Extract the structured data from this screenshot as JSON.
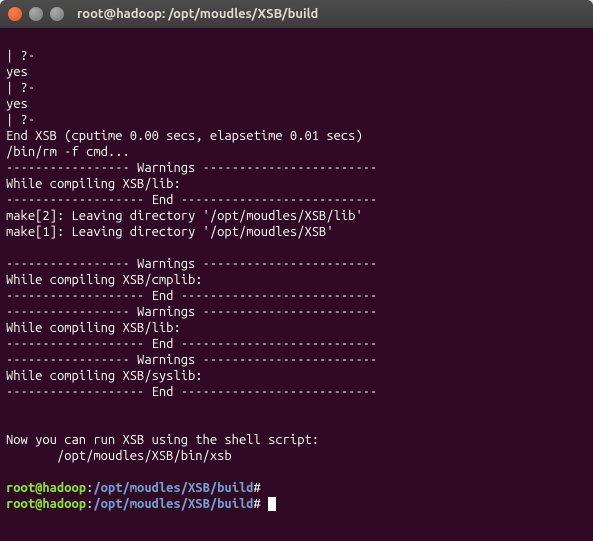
{
  "window": {
    "title": "root@hadoop: /opt/moudles/XSB/build"
  },
  "prompt": {
    "user_host": "root@hadoop",
    "sep": ":",
    "path": "/opt/moudles/XSB/build",
    "end": "#"
  },
  "lines": {
    "l0": "| ?-",
    "l1": "yes",
    "l2": "| ?-",
    "l3": "yes",
    "l4": "| ?-",
    "l5": "End XSB (cputime 0.00 secs, elapsetime 0.01 secs)",
    "l6": "/bin/rm -f cmd...",
    "l7": "----------------- Warnings ------------------------",
    "l8": "While compiling XSB/lib:",
    "l9": "------------------- End ---------------------------",
    "l10": "make[2]: Leaving directory '/opt/moudles/XSB/lib'",
    "l11": "make[1]: Leaving directory '/opt/moudles/XSB'",
    "l12": "",
    "l13": "----------------- Warnings ------------------------",
    "l14": "While compiling XSB/cmplib:",
    "l15": "------------------- End ---------------------------",
    "l16": "----------------- Warnings ------------------------",
    "l17": "While compiling XSB/lib:",
    "l18": "------------------- End ---------------------------",
    "l19": "----------------- Warnings ------------------------",
    "l20": "While compiling XSB/syslib:",
    "l21": "------------------- End ---------------------------",
    "l22": "",
    "l23": "",
    "l24": "Now you can run XSB using the shell script:",
    "l25": "       /opt/moudles/XSB/bin/xsb",
    "l26": ""
  }
}
